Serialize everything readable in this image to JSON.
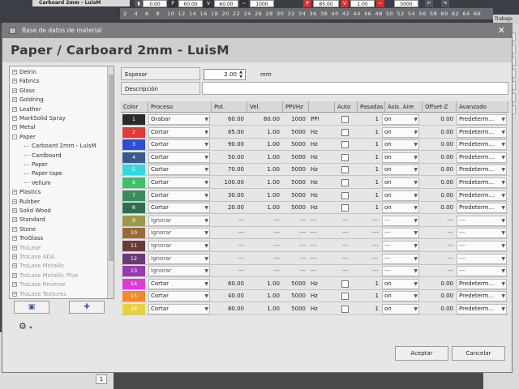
{
  "app": {
    "header_title": "Carboard 2mm - LuisM",
    "toolbar_values": [
      "0.00",
      "60.00",
      "60.00",
      "1000",
      "85.00",
      "1.00",
      "5000"
    ],
    "ruler_numbers": [
      "2",
      "4",
      "6",
      "8",
      "10",
      "12",
      "14",
      "16",
      "18",
      "20",
      "22",
      "24",
      "26",
      "28",
      "30",
      "32",
      "34",
      "36",
      "38",
      "40",
      "42",
      "44",
      "46",
      "48",
      "50",
      "52",
      "54",
      "56",
      "58",
      "60",
      "62",
      "64",
      "66"
    ],
    "right_panel_label": "Trabajo",
    "right_panel_items": [
      "N",
      "G",
      "S",
      "S",
      "S",
      "S",
      "S"
    ],
    "status_value": "1"
  },
  "dialog": {
    "window_title": "Base de datos de material",
    "heading": "Paper / Carboard 2mm - LuisM",
    "tree": [
      {
        "label": "Delrin",
        "level": 0,
        "expander": "+",
        "dim": false
      },
      {
        "label": "Fabrics",
        "level": 0,
        "expander": "+",
        "dim": false
      },
      {
        "label": "Glass",
        "level": 0,
        "expander": "+",
        "dim": false
      },
      {
        "label": "Goldring",
        "level": 0,
        "expander": "+",
        "dim": false
      },
      {
        "label": "Leather",
        "level": 0,
        "expander": "+",
        "dim": false
      },
      {
        "label": "MarkSolid Spray",
        "level": 0,
        "expander": "+",
        "dim": false
      },
      {
        "label": "Metal",
        "level": 0,
        "expander": "+",
        "dim": false
      },
      {
        "label": "Paper",
        "level": 0,
        "expander": "-",
        "dim": false
      },
      {
        "label": "Carboard 2mm - LuisM",
        "level": 1,
        "expander": "",
        "dim": false
      },
      {
        "label": "Cardboard",
        "level": 1,
        "expander": "",
        "dim": false
      },
      {
        "label": "Paper",
        "level": 1,
        "expander": "",
        "dim": false
      },
      {
        "label": "Paper tape",
        "level": 1,
        "expander": "",
        "dim": false
      },
      {
        "label": "Vellum",
        "level": 1,
        "expander": "",
        "dim": false
      },
      {
        "label": "Plastics",
        "level": 0,
        "expander": "+",
        "dim": false
      },
      {
        "label": "Rubber",
        "level": 0,
        "expander": "+",
        "dim": false
      },
      {
        "label": "Solid Wood",
        "level": 0,
        "expander": "+",
        "dim": false
      },
      {
        "label": "Standard",
        "level": 0,
        "expander": "+",
        "dim": false
      },
      {
        "label": "Stone",
        "level": 0,
        "expander": "+",
        "dim": false
      },
      {
        "label": "TroGlass",
        "level": 0,
        "expander": "+",
        "dim": false
      },
      {
        "label": "TroLase",
        "level": 0,
        "expander": "+",
        "dim": true
      },
      {
        "label": "TroLase ADA",
        "level": 0,
        "expander": "+",
        "dim": true
      },
      {
        "label": "TroLase Metallic",
        "level": 0,
        "expander": "+",
        "dim": true
      },
      {
        "label": "TroLase Metallic Plus",
        "level": 0,
        "expander": "+",
        "dim": true
      },
      {
        "label": "TroLase Reverse",
        "level": 0,
        "expander": "+",
        "dim": true
      },
      {
        "label": "TroLase Textures",
        "level": 0,
        "expander": "+",
        "dim": true
      }
    ],
    "form": {
      "espesor_label": "Espesor",
      "espesor_value": "2.00",
      "espesor_unit": "mm",
      "descripcion_label": "Descripción",
      "descripcion_value": ""
    },
    "columns": [
      "Color",
      "Proceso",
      "Pot.",
      "Vel.",
      "PPI/Hz",
      "",
      "Auto",
      "Pasadas",
      "Asis. Aire",
      "Offset-Z",
      "Avanzado"
    ],
    "rows": [
      {
        "n": "1",
        "color": "#2b2b2b",
        "proceso": "Grabar",
        "pot": "60.00",
        "vel": "60.00",
        "ppi": "1000",
        "unit": "PPI",
        "pasadas": "1",
        "aire": "on",
        "offset": "0.00",
        "avanzado": "Predeterm..."
      },
      {
        "n": "2",
        "color": "#e23a3a",
        "proceso": "Cortar",
        "pot": "85.00",
        "vel": "1.00",
        "ppi": "5000",
        "unit": "Hz",
        "pasadas": "1",
        "aire": "on",
        "offset": "0.00",
        "avanzado": "Predeterm..."
      },
      {
        "n": "3",
        "color": "#2c4fd6",
        "proceso": "Cortar",
        "pot": "90.00",
        "vel": "1.00",
        "ppi": "5000",
        "unit": "Hz",
        "pasadas": "1",
        "aire": "on",
        "offset": "0.00",
        "avanzado": "Predeterm..."
      },
      {
        "n": "4",
        "color": "#3a5a8e",
        "proceso": "Cortar",
        "pot": "50.00",
        "vel": "1.00",
        "ppi": "5000",
        "unit": "Hz",
        "pasadas": "1",
        "aire": "on",
        "offset": "0.00",
        "avanzado": "Predeterm..."
      },
      {
        "n": "5",
        "color": "#36d8e0",
        "proceso": "Cortar",
        "pot": "70.00",
        "vel": "1.00",
        "ppi": "5000",
        "unit": "Hz",
        "pasadas": "1",
        "aire": "on",
        "offset": "0.00",
        "avanzado": "Predeterm..."
      },
      {
        "n": "6",
        "color": "#3fbf6a",
        "proceso": "Cortar",
        "pot": "100.00",
        "vel": "1.00",
        "ppi": "5000",
        "unit": "Hz",
        "pasadas": "1",
        "aire": "on",
        "offset": "0.00",
        "avanzado": "Predeterm..."
      },
      {
        "n": "7",
        "color": "#3a8a5a",
        "proceso": "Cortar",
        "pot": "30.00",
        "vel": "1.00",
        "ppi": "5000",
        "unit": "Hz",
        "pasadas": "1",
        "aire": "on",
        "offset": "0.00",
        "avanzado": "Predeterm..."
      },
      {
        "n": "8",
        "color": "#2f6e4e",
        "proceso": "Cortar",
        "pot": "20.00",
        "vel": "1.00",
        "ppi": "5000",
        "unit": "Hz",
        "pasadas": "1",
        "aire": "on",
        "offset": "0.00",
        "avanzado": "Predeterm..."
      },
      {
        "n": "9",
        "color": "#9a9a4a",
        "proceso": "Ignorar",
        "pot": "---",
        "vel": "---",
        "ppi": "---",
        "unit": "---",
        "pasadas": "---",
        "aire": "---",
        "offset": "---",
        "avanzado": "---"
      },
      {
        "n": "10",
        "color": "#9a6a3a",
        "proceso": "Ignorar",
        "pot": "---",
        "vel": "---",
        "ppi": "---",
        "unit": "---",
        "pasadas": "---",
        "aire": "---",
        "offset": "---",
        "avanzado": "---"
      },
      {
        "n": "11",
        "color": "#6a3a3a",
        "proceso": "Ignorar",
        "pot": "---",
        "vel": "---",
        "ppi": "---",
        "unit": "---",
        "pasadas": "---",
        "aire": "---",
        "offset": "---",
        "avanzado": "---"
      },
      {
        "n": "12",
        "color": "#6a3a7a",
        "proceso": "Ignorar",
        "pot": "---",
        "vel": "---",
        "ppi": "---",
        "unit": "---",
        "pasadas": "---",
        "aire": "---",
        "offset": "---",
        "avanzado": "---"
      },
      {
        "n": "13",
        "color": "#9a3ab0",
        "proceso": "Ignorar",
        "pot": "---",
        "vel": "---",
        "ppi": "---",
        "unit": "---",
        "pasadas": "---",
        "aire": "---",
        "offset": "---",
        "avanzado": "---"
      },
      {
        "n": "14",
        "color": "#e03ad0",
        "proceso": "Cortar",
        "pot": "60.00",
        "vel": "1.00",
        "ppi": "5000",
        "unit": "Hz",
        "pasadas": "1",
        "aire": "on",
        "offset": "0.00",
        "avanzado": "Predeterm..."
      },
      {
        "n": "15",
        "color": "#f08a2a",
        "proceso": "Cortar",
        "pot": "40.00",
        "vel": "1.00",
        "ppi": "5000",
        "unit": "Hz",
        "pasadas": "1",
        "aire": "on",
        "offset": "0.00",
        "avanzado": "Predeterm..."
      },
      {
        "n": "16",
        "color": "#e8d23a",
        "proceso": "Cortar",
        "pot": "80.00",
        "vel": "1.00",
        "ppi": "5000",
        "unit": "Hz",
        "pasadas": "1",
        "aire": "on",
        "offset": "0.00",
        "avanzado": "Predeterm..."
      }
    ],
    "buttons": {
      "accept": "Aceptar",
      "cancel": "Cancelar"
    }
  }
}
